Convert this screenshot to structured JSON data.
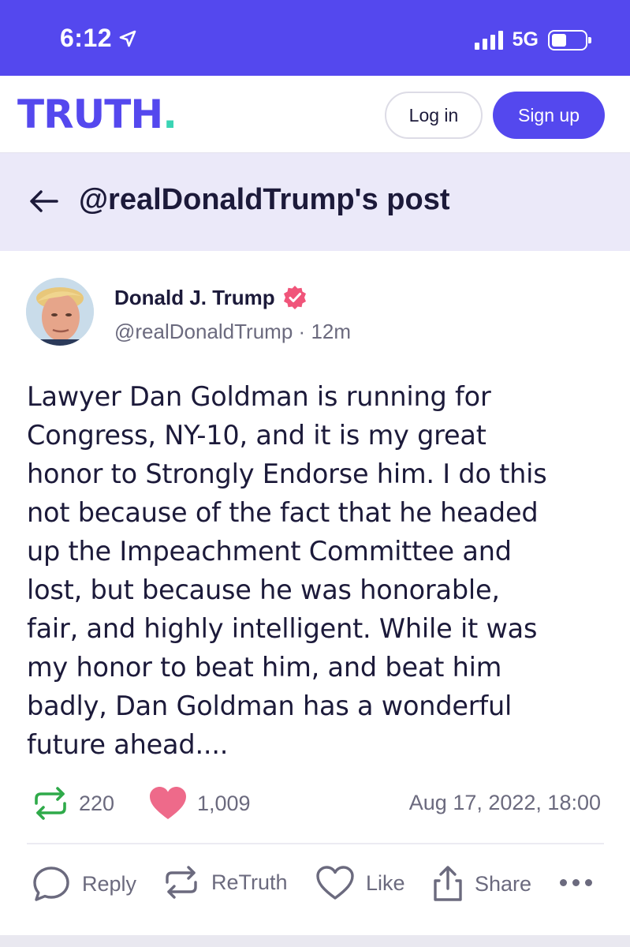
{
  "status_bar": {
    "time": "6:12",
    "network": "5G",
    "icons": [
      "location-arrow-icon",
      "signal-icon",
      "battery-icon"
    ]
  },
  "header": {
    "logo_text": "TRUTH",
    "logo_dot": ".",
    "login_label": "Log in",
    "signup_label": "Sign up",
    "brand_color": "#5448ee",
    "accent_color": "#3ad4b4"
  },
  "title_bar": {
    "title": "@realDonaldTrump's post",
    "background": "#ebe9f9"
  },
  "post": {
    "author_name": "Donald J. Trump",
    "verified": true,
    "handle": "@realDonaldTrump",
    "separator": "·",
    "time_ago": "12m",
    "text": "Lawyer Dan Goldman is running for\nCongress, NY-10, and it is my great\nhonor to Strongly Endorse him. I do this\nnot because of the fact that he headed\nup the Impeachment Committee and\nlost, but because he was honorable,\nfair, and highly intelligent. While it was\nmy honor to beat him, and beat him\nbadly, Dan Goldman has a wonderful\nfuture ahead....",
    "retruths": "220",
    "likes": "1,009",
    "date": "Aug 17, 2022, 18:00"
  },
  "actions": {
    "reply": "Reply",
    "retruth": "ReTruth",
    "like": "Like",
    "share": "Share"
  },
  "colors": {
    "retruth_green": "#2faa4a",
    "like_pink": "#ee6a8a",
    "muted": "#6b6a7e"
  }
}
